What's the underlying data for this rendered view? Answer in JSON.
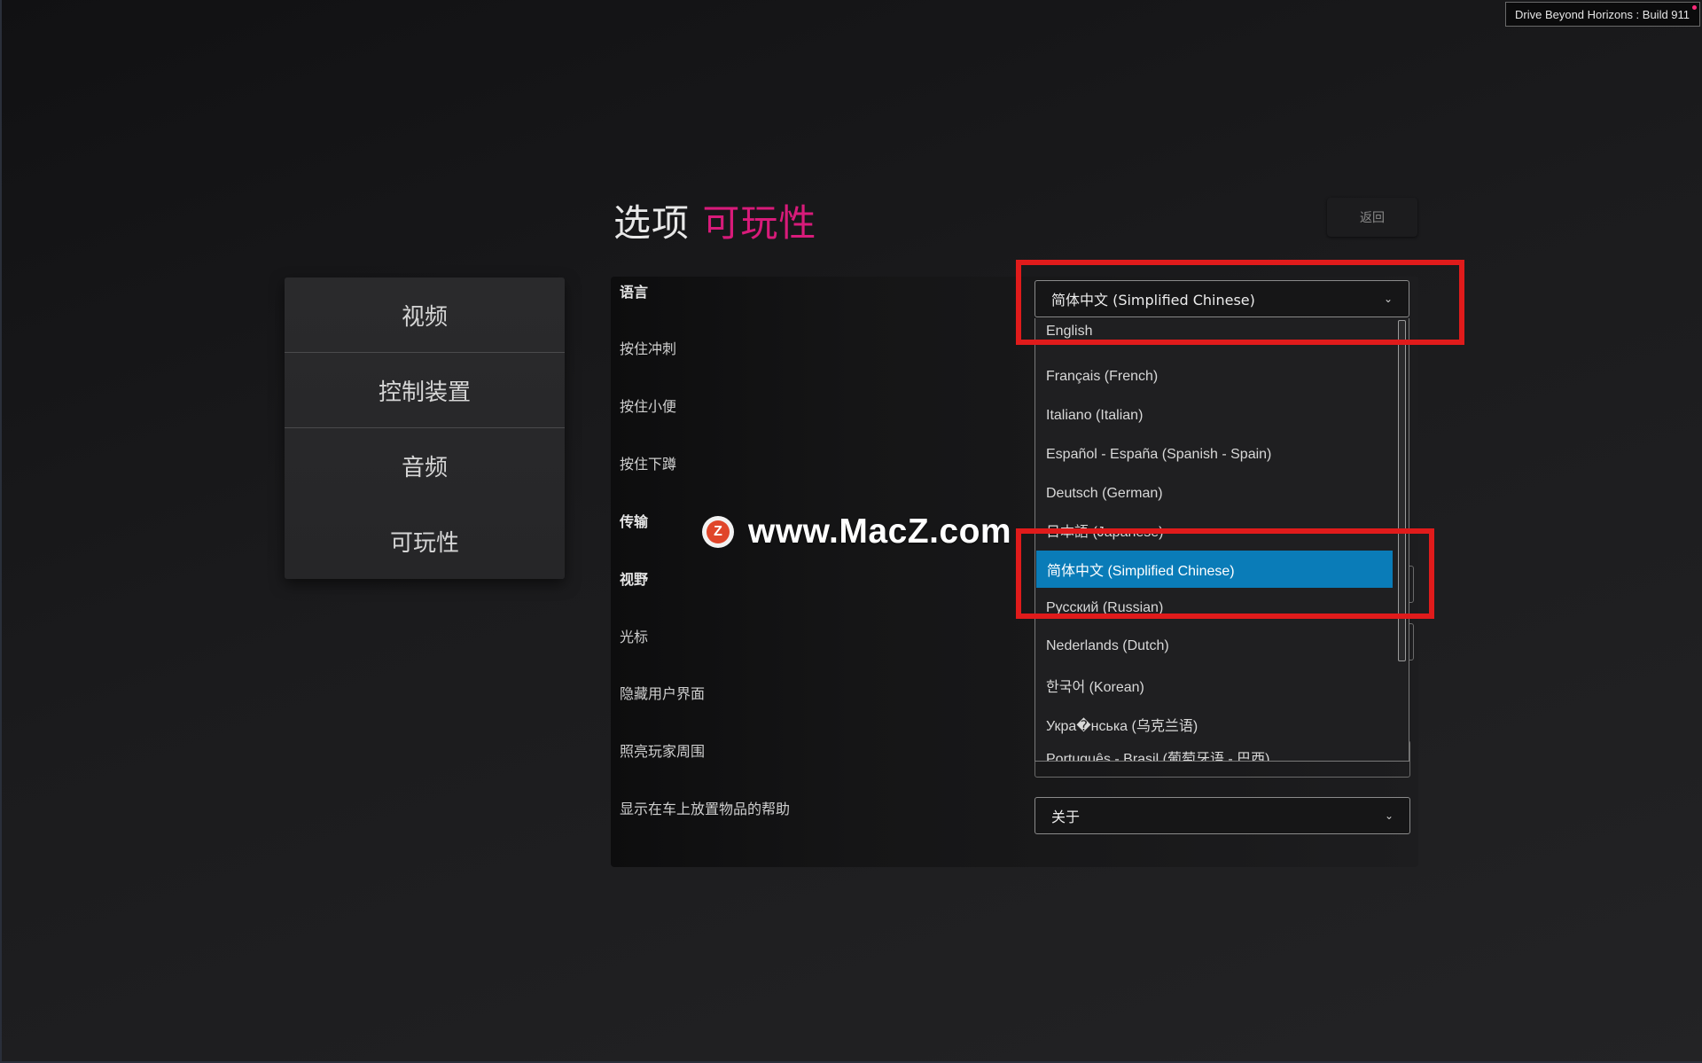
{
  "build_badge": "Drive Beyond Horizons : Build 911",
  "header": {
    "title_prefix": "选项",
    "title_accent": "可玩性",
    "back_label": "返回"
  },
  "categories": [
    {
      "label": "视频"
    },
    {
      "label": "控制装置"
    },
    {
      "label": "音频"
    },
    {
      "label": "可玩性"
    }
  ],
  "settings": [
    {
      "label": "语言"
    },
    {
      "label": "按住冲刺"
    },
    {
      "label": "按住小便"
    },
    {
      "label": "按住下蹲"
    },
    {
      "label": "传输"
    },
    {
      "label": "视野"
    },
    {
      "label": "光标"
    },
    {
      "label": "隐藏用户界面"
    },
    {
      "label": "照亮玩家周围"
    },
    {
      "label": "显示在车上放置物品的帮助"
    }
  ],
  "language_select": {
    "value": "简体中文 (Simplified Chinese)",
    "options": [
      "English",
      "Français (French)",
      "Italiano (Italian)",
      "Español - España (Spanish - Spain)",
      "Deutsch (German)",
      "日本語 (Japanese)",
      "简体中文 (Simplified Chinese)",
      "Русский (Russian)",
      "Nederlands (Dutch)",
      "한국어 (Korean)",
      "Укра�нська (乌克兰语)",
      "Português - Brasil (葡萄牙语 - 巴西)"
    ],
    "selected_index": 6
  },
  "item_help_select": {
    "value": "关于"
  },
  "watermark": {
    "logo_letter": "Z",
    "text": "www.MacZ.com"
  },
  "colors": {
    "accent": "#d81b7a",
    "selection": "#0a7cb8",
    "annotation": "#e01b1b"
  }
}
